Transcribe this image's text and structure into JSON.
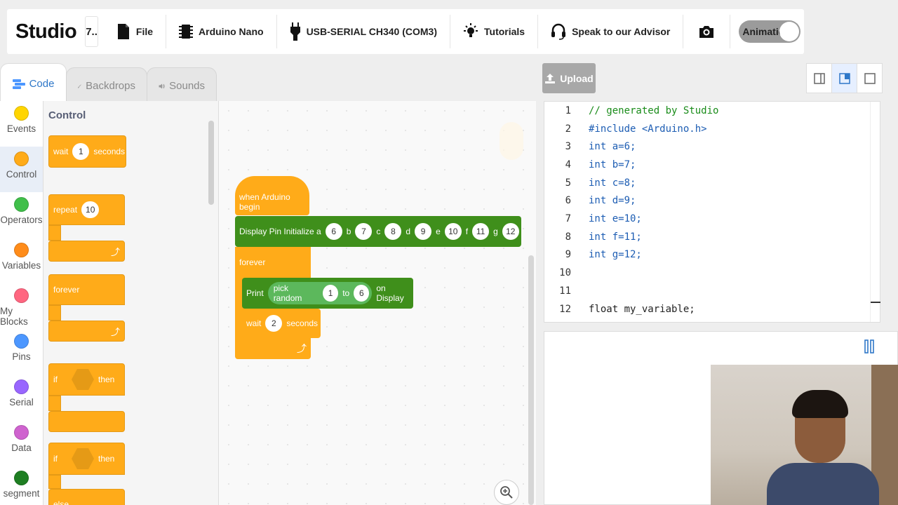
{
  "app": {
    "brand": "Studio",
    "project_short": "7..",
    "file_label": "File",
    "board_label": "Arduino Nano",
    "port_label": "USB-SERIAL CH340 (COM3)",
    "tutorials_label": "Tutorials",
    "advisor_label": "Speak to our Advisor",
    "animation_label": "Animation"
  },
  "tabs": [
    {
      "label": "Code",
      "active": true
    },
    {
      "label": "Backdrops",
      "active": false
    },
    {
      "label": "Sounds",
      "active": false
    }
  ],
  "categories": [
    {
      "label": "Events",
      "color": "#ffd500"
    },
    {
      "label": "Control",
      "color": "#ffab19"
    },
    {
      "label": "Operators",
      "color": "#40bf4a"
    },
    {
      "label": "Variables",
      "color": "#ff8c1a"
    },
    {
      "label": "My Blocks",
      "color": "#ff6680"
    },
    {
      "label": "Pins",
      "color": "#4c97ff"
    },
    {
      "label": "Serial",
      "color": "#9966ff"
    },
    {
      "label": "Data",
      "color": "#cf63cf"
    },
    {
      "label": "segment",
      "color": "#1e7e22"
    }
  ],
  "palette": {
    "title": "Control",
    "wait": {
      "label": "wait",
      "value": "1",
      "unit": "seconds"
    },
    "repeat": {
      "label": "repeat",
      "value": "10"
    },
    "forever": "forever",
    "if1": {
      "label": "if",
      "then": "then"
    },
    "if2": {
      "label": "if",
      "then": "then",
      "else": "else"
    }
  },
  "script": {
    "hat": "when Arduino begin",
    "display_init": {
      "label": "Display Pin Initialize a",
      "a": "6",
      "b_label": "b",
      "b": "7",
      "c_label": "c",
      "c": "8",
      "d_label": "d",
      "d": "9",
      "e_label": "e",
      "e": "10",
      "f_label": "f",
      "f": "11",
      "g_label": "g",
      "g": "12"
    },
    "forever": "forever",
    "print": {
      "label": "Print",
      "random_label": "pick random",
      "from": "1",
      "to_label": "to",
      "to": "6",
      "suffix": "on Display"
    },
    "wait": {
      "label": "wait",
      "value": "2",
      "unit": "seconds"
    }
  },
  "right": {
    "upload_label": "Upload"
  },
  "code_lines": [
    {
      "n": "1",
      "text": "// generated by Studio"
    },
    {
      "n": "2",
      "text": "#include <Arduino.h>"
    },
    {
      "n": "3",
      "text": "int a=6;"
    },
    {
      "n": "4",
      "text": "int b=7;"
    },
    {
      "n": "5",
      "text": "int c=8;"
    },
    {
      "n": "6",
      "text": "int d=9;"
    },
    {
      "n": "7",
      "text": "int e=10;"
    },
    {
      "n": "8",
      "text": "int f=11;"
    },
    {
      "n": "9",
      "text": "int g=12;"
    },
    {
      "n": "10",
      "text": ""
    },
    {
      "n": "11",
      "text": ""
    },
    {
      "n": "12",
      "text": "float my_variable;"
    }
  ]
}
